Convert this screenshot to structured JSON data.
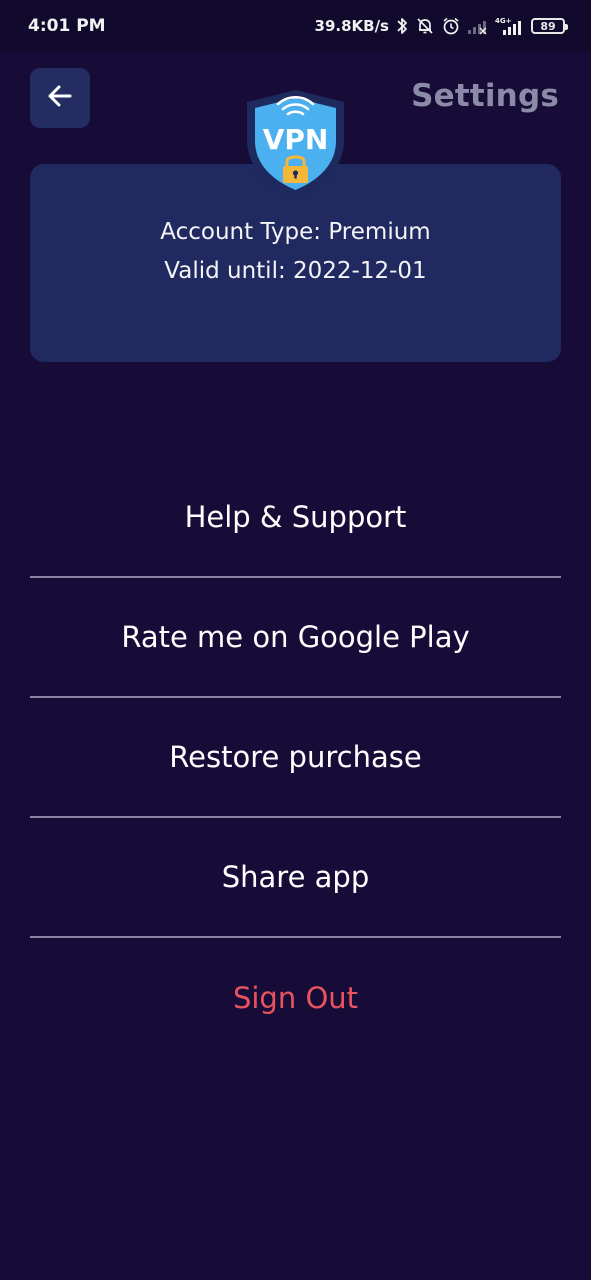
{
  "status_bar": {
    "time": "4:01 PM",
    "network_speed": "39.8KB/s",
    "battery_level": "89",
    "icons": [
      "bluetooth-icon",
      "bell-muted-icon",
      "alarm-icon",
      "signal-empty-icon",
      "signal-4g-icon",
      "battery-icon"
    ]
  },
  "header": {
    "title": "Settings",
    "back_icon": "arrow-left-icon"
  },
  "account": {
    "badge_text": "VPN",
    "type_line": "Account Type: Premium",
    "valid_line": "Valid until: 2022-12-01"
  },
  "menu": {
    "items": [
      {
        "label": "Help & Support"
      },
      {
        "label": "Rate me on Google Play"
      },
      {
        "label": "Restore purchase"
      },
      {
        "label": "Share app"
      },
      {
        "label": "Sign Out"
      }
    ]
  },
  "colors": {
    "background": "#170c38",
    "card": "#212a60",
    "signout": "#e8535e",
    "title_muted": "#8b8aa7",
    "shield_blue": "#4ab0ef",
    "shield_navy": "#1e2a5e"
  }
}
